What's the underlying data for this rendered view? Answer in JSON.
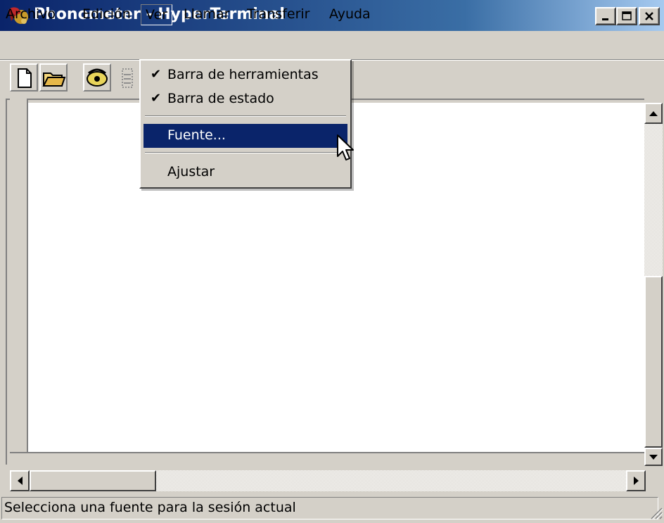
{
  "window": {
    "title": "Phonometer - HyperTerminal",
    "icon": "hyperterminal-phone-icon",
    "caption_buttons": [
      "minimize-icon",
      "maximize-icon",
      "close-icon"
    ]
  },
  "menubar": {
    "items": [
      {
        "label": "Archivo"
      },
      {
        "label": "Edición"
      },
      {
        "label": "Ver"
      },
      {
        "label": "Llamar"
      },
      {
        "label": "Transferir"
      },
      {
        "label": "Ayuda"
      }
    ]
  },
  "toolbar": {
    "buttons": [
      "new-document-icon",
      "open-folder-icon",
      "phone-connect-icon",
      "phone-disconnect-icon"
    ]
  },
  "ver_menu": {
    "items": [
      {
        "label": "Barra de herramientas",
        "checked": true
      },
      {
        "label": "Barra de estado",
        "checked": true
      },
      {
        "label": "Fuente...",
        "highlighted": true
      },
      {
        "label": "Ajustar"
      }
    ]
  },
  "status": {
    "text": "Selecciona una fuente para la sesión actual"
  },
  "colors": {
    "titlebar_start": "#0a246a",
    "titlebar_end": "#a6caf0",
    "menu_highlight": "#0a246a",
    "face": "#d4d0c8"
  }
}
